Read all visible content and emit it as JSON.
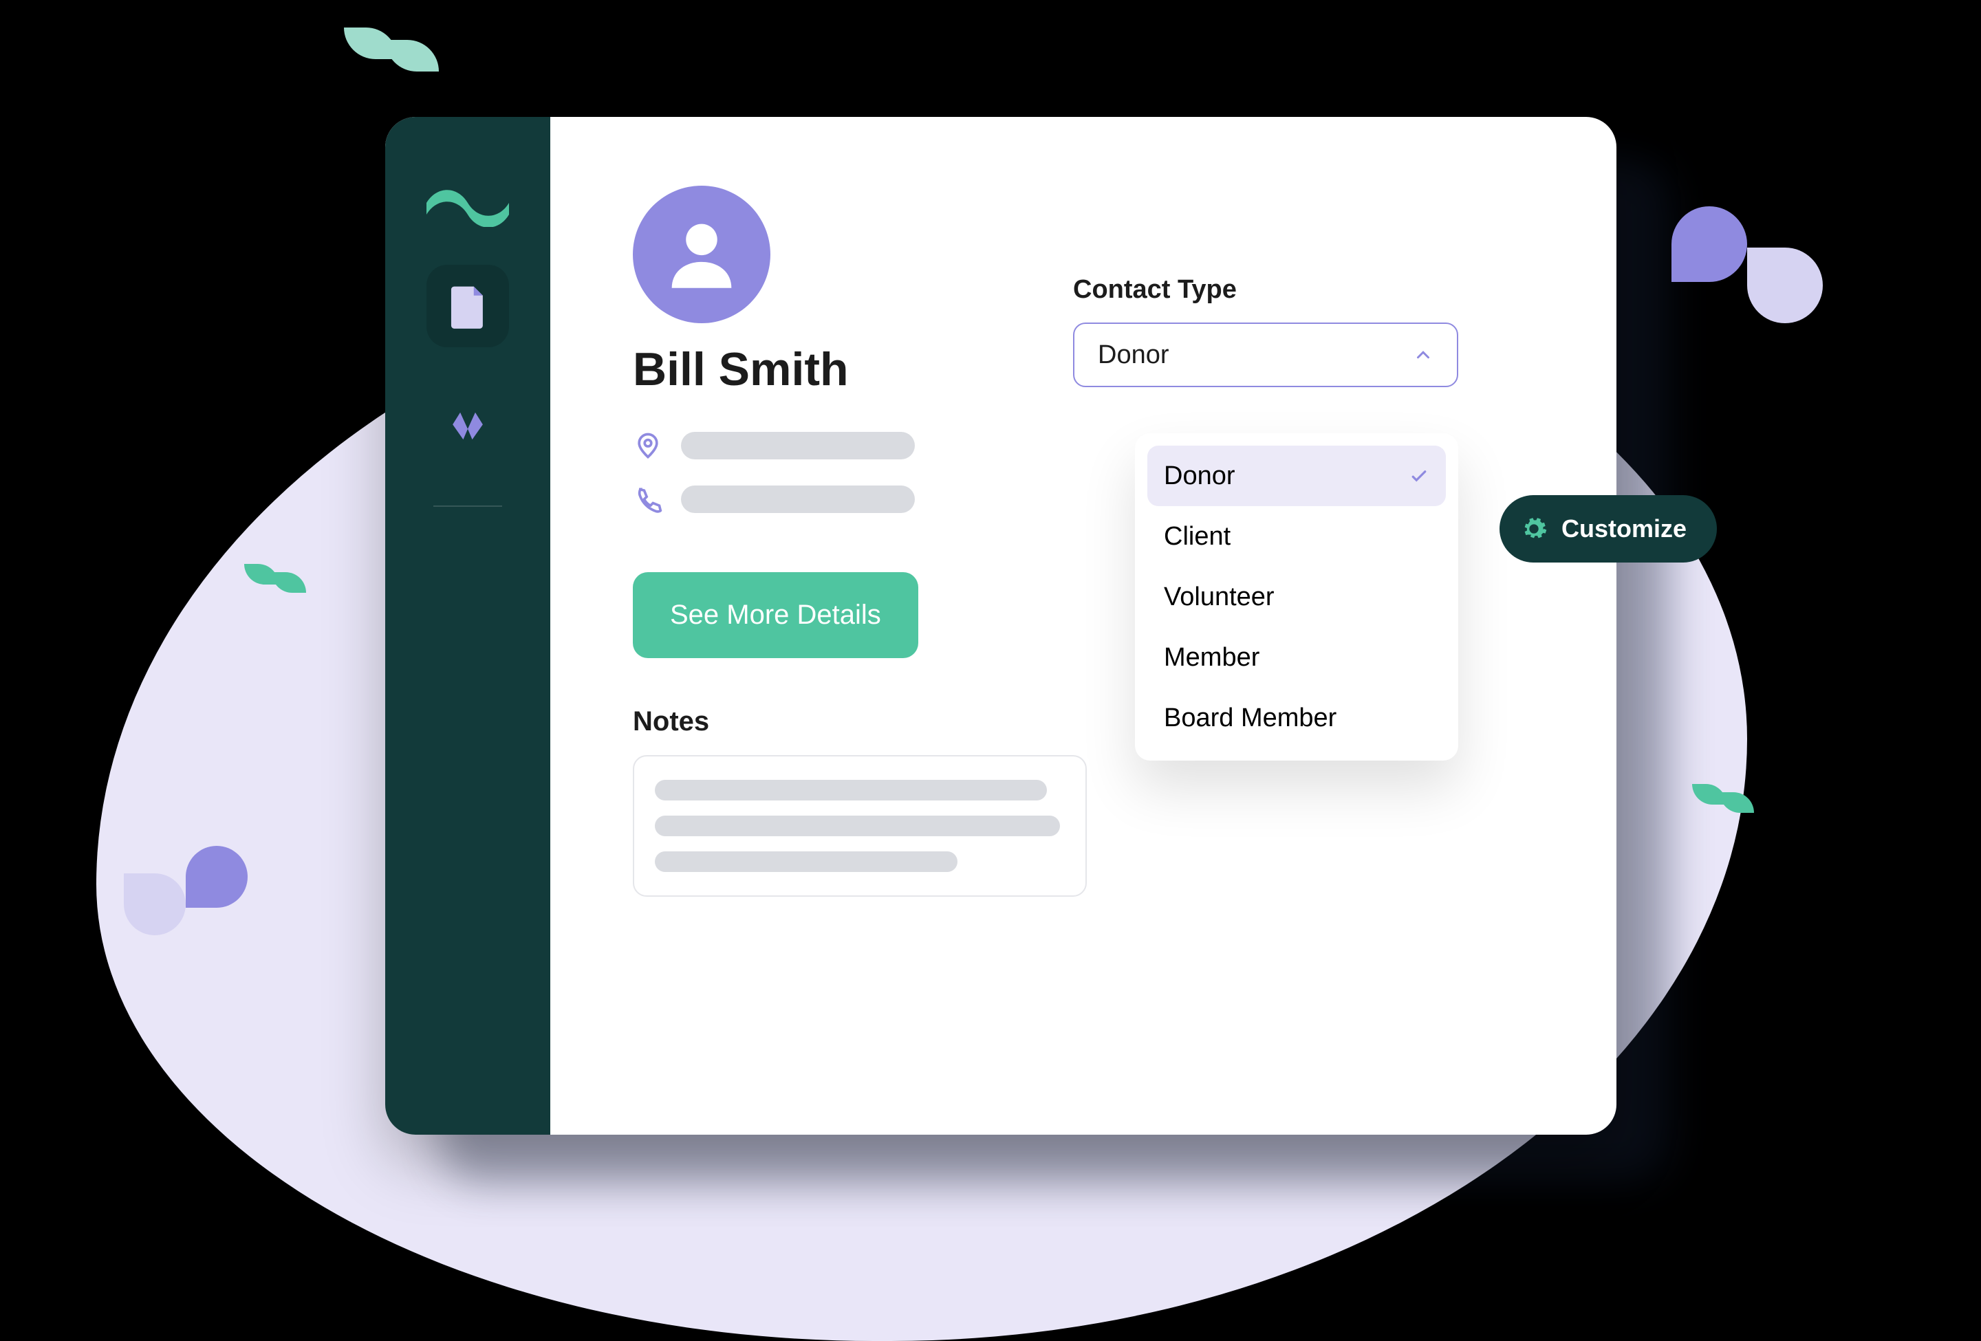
{
  "sidebar": {
    "logo_name": "brand-wave-logo",
    "nav": [
      {
        "name": "documents",
        "active": true
      },
      {
        "name": "community",
        "active": false
      }
    ]
  },
  "profile": {
    "name": "Bill Smith",
    "see_more_label": "See More Details"
  },
  "notes": {
    "label": "Notes"
  },
  "contact_type": {
    "label": "Contact Type",
    "selected": "Donor",
    "options": [
      "Donor",
      "Client",
      "Volunteer",
      "Member",
      "Board Member"
    ]
  },
  "customize": {
    "label": "Customize"
  },
  "colors": {
    "green": "#4fc5a0",
    "purple": "#8f8ae0",
    "dark": "#123a3a"
  }
}
